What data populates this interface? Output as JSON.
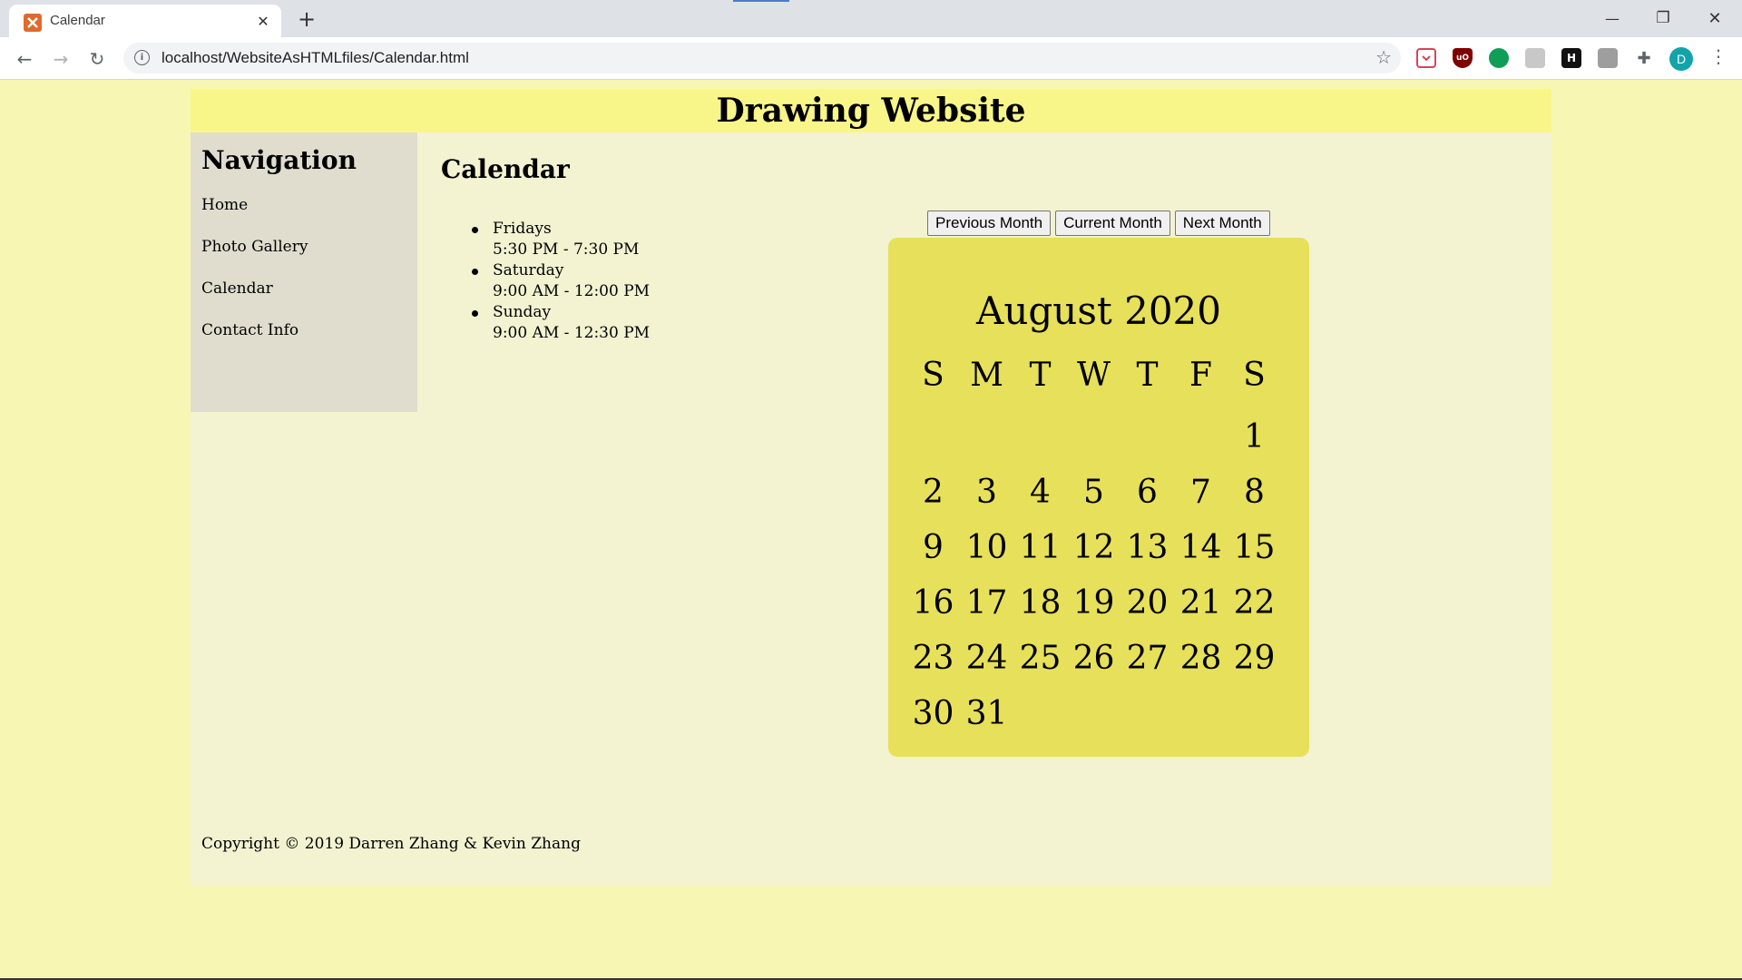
{
  "browser": {
    "tab_title": "Calendar",
    "tab_close": "✕",
    "new_tab": "+",
    "url": "localhost/WebsiteAsHTMLfiles/Calendar.html",
    "avatar_letter": "D",
    "window_controls": {
      "minimize": "—",
      "maximize": "❐",
      "close": "✕"
    },
    "nav_icons": {
      "back": "←",
      "forward": "→",
      "reload": "↻",
      "bookmark": "☆",
      "menu": "⋮"
    },
    "extensions": [
      "pocket-icon",
      "ublock-icon",
      "green-dot-icon",
      "puzzle-gray-icon",
      "h-icon",
      "camera-icon",
      "extensions-icon"
    ],
    "ext_letters": {
      "ublock": "uO",
      "h": "H"
    }
  },
  "site": {
    "header_title": "Drawing Website",
    "sidebar": {
      "heading": "Navigation",
      "items": [
        {
          "label": "Home"
        },
        {
          "label": "Photo Gallery"
        },
        {
          "label": "Calendar"
        },
        {
          "label": "Contact Info"
        }
      ]
    },
    "main": {
      "title": "Calendar",
      "schedule": [
        {
          "day": "Fridays",
          "time": "5:30 PM - 7:30 PM"
        },
        {
          "day": "Saturday",
          "time": "9:00 AM - 12:00 PM"
        },
        {
          "day": "Sunday",
          "time": "9:00 AM - 12:30 PM"
        }
      ]
    },
    "calendar": {
      "buttons": {
        "previous": "Previous Month",
        "current": "Current Month",
        "next": "Next Month"
      },
      "month_label": "August 2020",
      "weekdays": [
        "S",
        "M",
        "T",
        "W",
        "T",
        "F",
        "S"
      ],
      "first_weekday_index": 6,
      "days_in_month": 31
    },
    "footer": "Copyright © 2019 Darren Zhang & Kevin Zhang"
  },
  "colors": {
    "page_bg": "#f7f7b3",
    "header_bg": "#f9f689",
    "content_bg": "#f3f2d1",
    "sidebar_bg": "#e0ddcf",
    "calendar_bg": "#e7e05a"
  }
}
